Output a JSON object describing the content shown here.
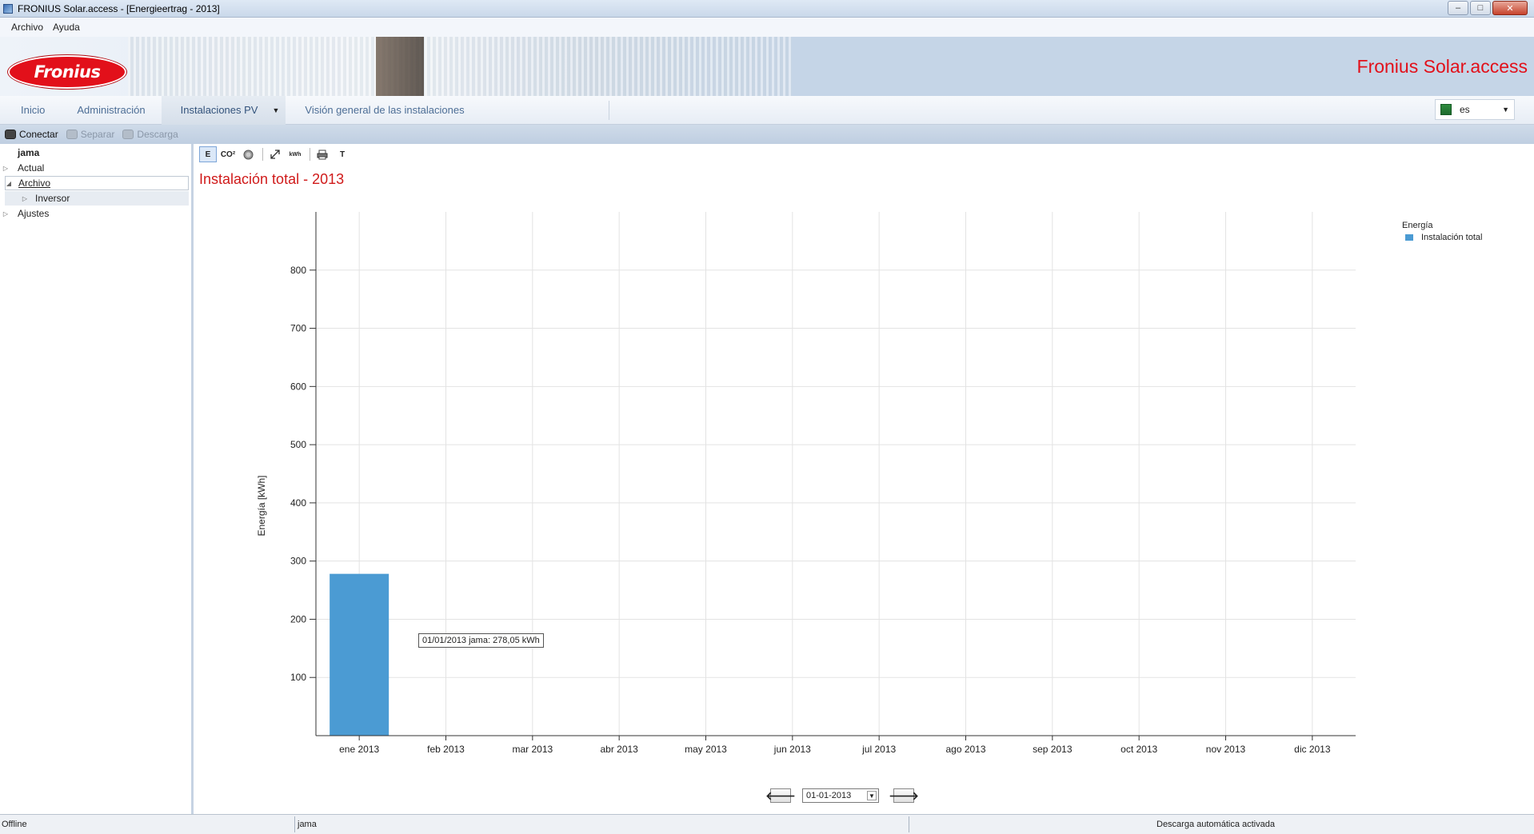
{
  "window": {
    "title": "FRONIUS Solar.access - [Energieertrag - 2013]",
    "buttons": {
      "minimize": "–",
      "maximize": "□",
      "close": "✕"
    }
  },
  "menu": {
    "items": [
      "Archivo",
      "Ayuda"
    ]
  },
  "banner": {
    "logo_text": "Fronius",
    "product_title": "Fronius Solar.access"
  },
  "nav": {
    "tabs": [
      "Inicio",
      "Administración",
      "Instalaciones PV",
      "Visión general de las instalaciones"
    ],
    "language": "es"
  },
  "connection": {
    "connect": "Conectar",
    "disconnect": "Separar",
    "download": "Descarga"
  },
  "sidebar": {
    "root": "jama",
    "items": {
      "actual": "Actual",
      "archivo": "Archivo",
      "inversor": "Inversor",
      "ajustes": "Ajustes"
    }
  },
  "toolbar": {
    "energy": "E",
    "co2": "CO²",
    "units": "kWh",
    "text": "T"
  },
  "icons": {
    "app": "app-icon",
    "logo": "fronius-logo",
    "flag": "excel-flag-icon",
    "connect": "phone-connect-icon",
    "disconnect": "phone-disconnect-icon",
    "download": "download-icon",
    "coin": "coin-icon",
    "expand": "expand-icon",
    "print": "printer-icon"
  },
  "chart_title": "Instalación total - 2013",
  "chart_data": {
    "type": "bar",
    "categories": [
      "ene 2013",
      "feb 2013",
      "mar 2013",
      "abr 2013",
      "may 2013",
      "jun 2013",
      "jul 2013",
      "ago 2013",
      "sep 2013",
      "oct 2013",
      "nov 2013",
      "dic 2013"
    ],
    "series": [
      {
        "name": "Instalación total",
        "values": [
          278.05,
          0,
          0,
          0,
          0,
          0,
          0,
          0,
          0,
          0,
          0,
          0
        ],
        "color": "#4b9bd3"
      }
    ],
    "ylabel": "Energía [kWh]",
    "yticks": [
      100,
      200,
      300,
      400,
      500,
      600,
      700,
      800
    ],
    "ylim": [
      0,
      900
    ],
    "grid": true,
    "legend_title": "Energía",
    "legend_position": "top-right"
  },
  "tooltip": "01/01/2013 jama: 278,05 kWh",
  "date_nav": {
    "prev": "🡐",
    "next": "🡒",
    "date": "01-01-2013"
  },
  "status": {
    "connection": "Offline",
    "system": "jama",
    "download": "Descarga automática activada"
  }
}
